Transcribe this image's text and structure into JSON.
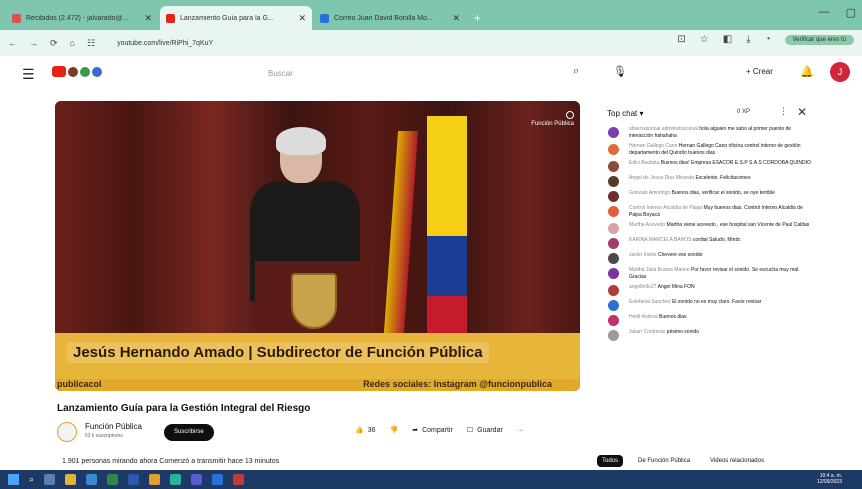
{
  "browser": {
    "tabs": [
      {
        "title": "Recibidos (2.472) - jalvarado@...",
        "color": "#d9534f",
        "active": false
      },
      {
        "title": "Lanzamiento Guía para la G...",
        "color": "#e62117",
        "active": true
      },
      {
        "title": "Correo Juan David Bonilla Mo...",
        "color": "#2a6fdb",
        "active": false
      }
    ],
    "new_tab": "+",
    "url": "youtube.com/live/RiPhi_7qKuY",
    "sync_label": "Verificar que eres tú"
  },
  "youtube": {
    "search_placeholder": "Buscar",
    "create_label": "Crear",
    "avatar_letter": "J"
  },
  "video": {
    "brand_label": "Función Pública",
    "lower_third": "Jesús Hernando Amado | Subdirector de Función Pública",
    "strip_left": "publicacol",
    "strip_right": "Redes sociales: Instagram @funcionpublica",
    "title": "Lanzamiento Guía para la Gestión Integral del Riesgo",
    "channel_name": "Función Pública",
    "channel_subs": "63 k suscriptores",
    "subscribe_label": "Suscribirse",
    "likes": "36",
    "share_label": "Compartir",
    "save_label": "Guardar",
    "more_label": "···",
    "viewers_line": "1.901 personas mirando ahora  Comenzó a transmitir hace 13 minutos"
  },
  "chat": {
    "header_label": "Top chat ▾",
    "xp_label": "0 XP",
    "messages": [
      {
        "who": "observatorioal administracional",
        "text": "hola alguien me subo al primer puesto de interacción hahahaha",
        "color": "#7b3fb0"
      },
      {
        "who": "Hernan Gallego Cano",
        "text": "Hernan Gallego Cano oficina control interno de gestión departamento del Quindío buenos dias",
        "color": "#e56a3b"
      },
      {
        "who": "Edici Bautista",
        "text": "Buenos dias! Empresa ESACOR E.S.P S.A.S CORDOBA QUINDIO",
        "color": "#8c4a3b"
      },
      {
        "who": "Angel de Jesus Diaz Miranda",
        "text": "Excelente. Felicitaciones",
        "color": "#5a3b2a"
      },
      {
        "who": "Gonzalo Amoringo",
        "text": "Buenos dias, verificar el sonido, se oye terrible",
        "color": "#6b2f2f"
      },
      {
        "who": "Control Interno Alcaldía de Paipa",
        "text": "Muy buenos dias. Control Interno Alcaldia de Paipa Boyacá",
        "color": "#e0603b"
      },
      {
        "who": "Martha Acevedo",
        "text": "Martha viene acevedo , ese hospital san Vicente de Paul Caldas",
        "color": "#d7a3a3"
      },
      {
        "who": "KARINA MARCELA BAHOS",
        "text": "cordial Saludo, Mintic",
        "color": "#a03b6b"
      },
      {
        "who": "Javier Iriarte",
        "text": "Chevere ese sonido",
        "color": "#4a4a4a"
      },
      {
        "who": "Martha Julia Bustos Marino",
        "text": "Por favor revisar el sonido. Se escucha muy mal. Gracias",
        "color": "#7b2fa0"
      },
      {
        "who": "angelbrito27",
        "text": "Angel Mina FON",
        "color": "#b03b3b"
      },
      {
        "who": "Estefania Sanchez",
        "text": "El sonido no es muy claro. Favor revisar",
        "color": "#2f6fd0"
      },
      {
        "who": "Heidi Andrea",
        "text": "Buenos dias",
        "color": "#c0306b"
      },
      {
        "who": "Julian Contreras",
        "text": "pésimo sonido",
        "color": "#9a9a9a"
      }
    ],
    "tabs": [
      {
        "label": "Todos",
        "active": true
      },
      {
        "label": "De Función Pública",
        "active": false
      },
      {
        "label": "Videos relacionados",
        "active": false
      }
    ]
  },
  "taskbar": {
    "clock_time": "10:4 a. m.",
    "clock_date": "12/09/2023"
  }
}
